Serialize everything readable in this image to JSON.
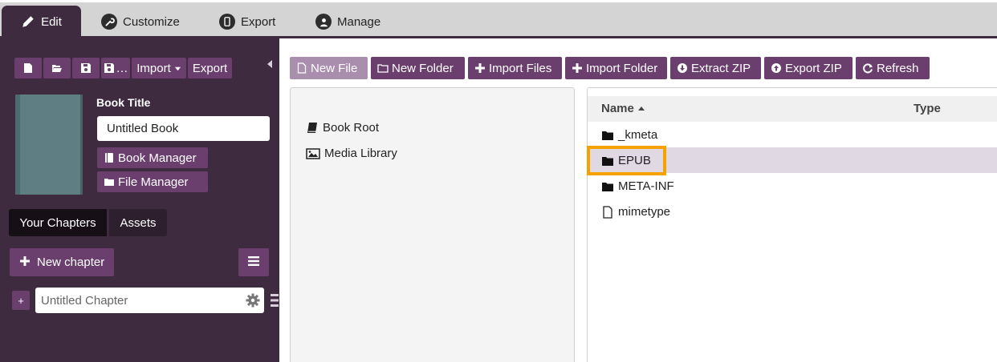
{
  "tabs": [
    {
      "label": "Edit",
      "icon": "pencil-icon",
      "active": true
    },
    {
      "label": "Customize",
      "icon": "wrench-icon",
      "active": false
    },
    {
      "label": "Export",
      "icon": "phone-icon",
      "active": false
    },
    {
      "label": "Manage",
      "icon": "user-icon",
      "active": false
    }
  ],
  "toolbar": {
    "new_icon": "file-icon",
    "open_icon": "folder-open-icon",
    "save_icon": "save-icon",
    "save_as_label": "…",
    "import_label": "Import",
    "export_label": "Export"
  },
  "book": {
    "title_label": "Book Title",
    "title_value": "Untitled Book",
    "book_manager_label": "Book Manager",
    "file_manager_label": "File Manager"
  },
  "chapters": {
    "tab_your_chapters": "Your Chapters",
    "tab_assets": "Assets",
    "new_chapter_label": "New chapter",
    "add_symbol": "+",
    "chapter_placeholder": "Untitled Chapter"
  },
  "file_manager": {
    "buttons": {
      "new_file": "New File",
      "new_folder": "New Folder",
      "import_files": "Import Files",
      "import_folder": "Import Folder",
      "extract_zip": "Extract ZIP",
      "export_zip": "Export ZIP",
      "refresh": "Refresh"
    },
    "tree": [
      "Book Root",
      "Media Library"
    ],
    "columns": {
      "name": "Name",
      "type": "Type"
    },
    "rows": [
      {
        "name": "_kmeta",
        "kind": "folder"
      },
      {
        "name": "EPUB",
        "kind": "folder",
        "selected": true
      },
      {
        "name": "META-INF",
        "kind": "folder"
      },
      {
        "name": "mimetype",
        "kind": "file"
      }
    ]
  },
  "colors": {
    "panel_dark": "#3f2b40",
    "button_purple": "#6a3f6e",
    "highlight_orange": "#f5a100",
    "selected_row": "#e0d8e3"
  }
}
